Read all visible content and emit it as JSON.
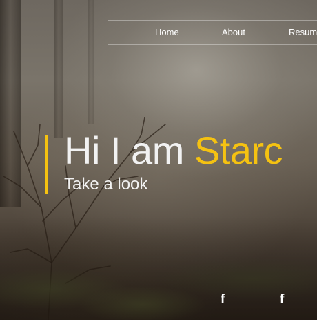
{
  "nav": {
    "items": [
      {
        "label": "Home"
      },
      {
        "label": "About"
      },
      {
        "label": "Resum"
      }
    ]
  },
  "hero": {
    "greeting": "Hi I am ",
    "name": "Starc",
    "subtitle": "Take a look"
  },
  "social": {
    "icons": [
      {
        "icon": "facebook-icon",
        "glyph": "f"
      },
      {
        "icon": "facebook-icon",
        "glyph": "f"
      }
    ]
  },
  "colors": {
    "accent": "#f5c211",
    "text": "#f2f2f2"
  }
}
